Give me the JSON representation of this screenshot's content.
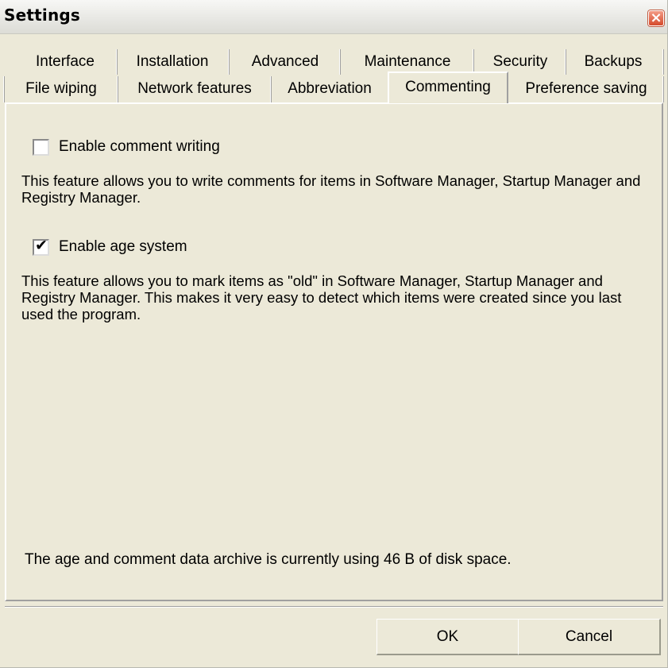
{
  "window": {
    "title": "Settings",
    "close_glyph": "×"
  },
  "tabs": {
    "row1": [
      "Interface",
      "Installation",
      "Advanced",
      "Maintenance",
      "Security",
      "Backups"
    ],
    "row2": [
      "File wiping",
      "Network features",
      "Abbreviation",
      "Commenting",
      "Preference saving"
    ],
    "active": "Commenting"
  },
  "options": {
    "comment_writing": {
      "label": "Enable comment writing",
      "checked": false,
      "description": "This feature allows you to write comments for items in Software Manager, Startup Manager and Registry Manager."
    },
    "age_system": {
      "label": "Enable age system",
      "checked": true,
      "check_glyph": "✔",
      "description": "This feature allows you to mark items as \"old\" in Software Manager, Startup Manager and Registry Manager. This makes it very easy to detect which items were created since you last used the program."
    }
  },
  "archive_info": "The age and comment data archive is currently using 46 B of disk space.",
  "buttons": {
    "ok": "OK",
    "cancel": "Cancel"
  }
}
